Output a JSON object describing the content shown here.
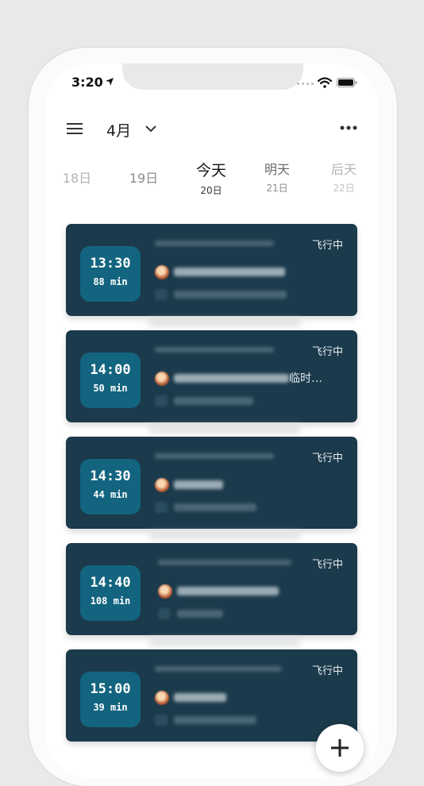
{
  "status_bar": {
    "time": "3:20"
  },
  "header": {
    "month": "4月"
  },
  "days": [
    {
      "label": "18日",
      "sub": ""
    },
    {
      "label": "19日",
      "sub": ""
    },
    {
      "label": "今天",
      "sub": "20日"
    },
    {
      "label": "明天",
      "sub": "21日"
    },
    {
      "label": "后天",
      "sub": "22日"
    }
  ],
  "flights": [
    {
      "time": "13:30",
      "duration": "88 min",
      "status": "飞行中",
      "visible_text": ""
    },
    {
      "time": "14:00",
      "duration": "50 min",
      "status": "飞行中",
      "visible_text": "临时…"
    },
    {
      "time": "14:30",
      "duration": "44 min",
      "status": "飞行中",
      "visible_text": ""
    },
    {
      "time": "14:40",
      "duration": "108 min",
      "status": "飞行中",
      "visible_text": ""
    },
    {
      "time": "15:00",
      "duration": "39 min",
      "status": "飞行中",
      "visible_text": ""
    }
  ],
  "colors": {
    "card": "#1b3a4b",
    "time_box": "#13647f",
    "accent": "#13647f"
  }
}
